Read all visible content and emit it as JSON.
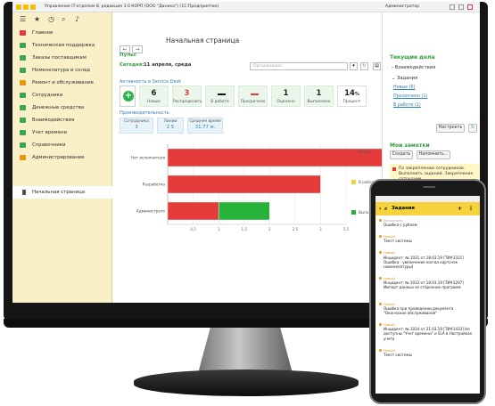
{
  "window": {
    "title": "Управление IT-отделом 8, редакция 3.0 КОРП (ООО \"Даника\") (1С:Предприятие)",
    "user": "Администратор"
  },
  "sidebar": {
    "items": [
      {
        "label": "Главное",
        "color": "#e53a3a"
      },
      {
        "label": "Техническая поддержка",
        "color": "#3aa84b"
      },
      {
        "label": "Заказы поставщикам",
        "color": "#3aa84b"
      },
      {
        "label": "Номенклатура и склад",
        "color": "#3aa84b"
      },
      {
        "label": "Ремонт и обслуживание",
        "color": "#e59a15"
      },
      {
        "label": "Сотрудники",
        "color": "#3aa84b"
      },
      {
        "label": "Денежные средства",
        "color": "#3aa84b"
      },
      {
        "label": "Взаимодействия",
        "color": "#3aa84b"
      },
      {
        "label": "Учет времени",
        "color": "#3aa84b"
      },
      {
        "label": "Справочники",
        "color": "#3aa84b"
      },
      {
        "label": "Администрирование",
        "color": "#e59a15"
      }
    ],
    "current": "Начальная страница"
  },
  "main": {
    "title": "Начальная страница",
    "pulse_label": "Пульс",
    "today_label": "Сегодня:",
    "today_value": "11 апреля, среда",
    "org_placeholder": "Организация",
    "service_desk_label": "Активность в Service Desk",
    "tiles": [
      {
        "value": "6",
        "label": "Новые",
        "color": "#222"
      },
      {
        "value": "3",
        "label": "Распределить",
        "color": "#e53a3a"
      },
      {
        "value": "",
        "label": "В работе",
        "mark": "#111"
      },
      {
        "value": "",
        "label": "Просрочено",
        "mark": "#e53a3a"
      },
      {
        "value": "1",
        "label": "Оценено",
        "color": "#222"
      },
      {
        "value": "1",
        "label": "Выполнено",
        "color": "#222"
      },
      {
        "value": "14",
        "suffix": "%",
        "label": "Процент",
        "color": "#222"
      }
    ],
    "productivity_label": "Производительность",
    "prod_tiles": [
      {
        "label": "Сотрудника",
        "value": "3"
      },
      {
        "label": "Линии",
        "value": "2 5"
      },
      {
        "label": "Среднее время",
        "value": "31,77 м."
      }
    ]
  },
  "chart_data": {
    "type": "bar",
    "orientation": "horizontal",
    "stacked": true,
    "categories": [
      "Нет исполнителя",
      "Разработка",
      "Администрато"
    ],
    "series": [
      {
        "name": "Новые",
        "color": "#e53a3a",
        "values": [
          6,
          3,
          1
        ]
      },
      {
        "name": "В работе",
        "color": "#e8d23a",
        "values": [
          0,
          0,
          0
        ]
      },
      {
        "name": "Выполнено",
        "color": "#27b23a",
        "values": [
          0,
          0,
          1
        ]
      }
    ],
    "xticks": [
      "0,5",
      "1",
      "1,5",
      "2",
      "2,5",
      "3",
      "3,5"
    ],
    "xlim": [
      0,
      3.5
    ],
    "legend": "right"
  },
  "right": {
    "tasks_title": "Текущие дела",
    "interactions": "Взаимодействия",
    "tasks": "Задания",
    "links": [
      "Новые (6)",
      "Просрочено (1)",
      "В работе (1)"
    ],
    "setup_button": "Настроить",
    "notes_title": "Мои заметки",
    "create_button": "Создать",
    "remind_button": "Напомнить...",
    "note_text": "По закреплению сотрудников. Выполнить заданий. Закрепление сотрудник..."
  },
  "phone": {
    "header": "Задания",
    "items": [
      {
        "status": "Исполнить",
        "text": "Ошибка с рублем"
      },
      {
        "status": "Новый",
        "text": "Текст системы"
      },
      {
        "status": "Новый",
        "text": "Инцидент: № 1031 от 18.03.19 [ТИ#3321] Ошибка - увеличение кол-ва карточек номенклатуры]"
      },
      {
        "status": "Новый",
        "text": "Инцидент: № 1032 от 18.03.19 [ТИ#3297] Импорт данных из сторонних программ"
      },
      {
        "status": "Новый",
        "text": "Ошибка при проведении документа \"Окончание обслуживания\""
      },
      {
        "status": "Новый",
        "text": "Инцидент: № 1034 от 21.03.19 [ТИ#3433] Не доступны \"Учет времени\" и SLA в Настройках учета"
      },
      {
        "status": "Новый",
        "text": "Текст системы"
      }
    ]
  }
}
